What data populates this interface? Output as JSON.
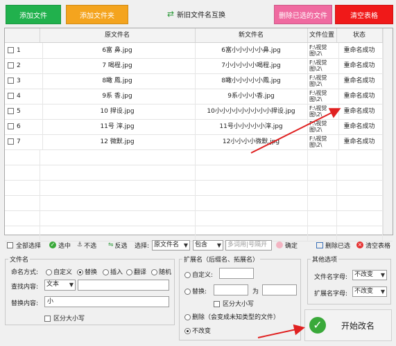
{
  "colors": {
    "add_file": "#21b14d",
    "add_folder": "#f4a41e",
    "delete_selected": "#f06aa0",
    "clear_table": "#f01919",
    "arrow": "#e02020",
    "success_green": "#3aa93a"
  },
  "top_buttons": {
    "add_file": "添加文件",
    "add_folder": "添加文件夹",
    "swap": "新旧文件名互换",
    "delete_selected": "删除已选的文件",
    "clear_table": "清空表格"
  },
  "table": {
    "headers": {
      "orig": "原文件名",
      "new": "新文件名",
      "loc": "文件位置",
      "status": "状态"
    },
    "rows": [
      {
        "num": "1",
        "orig": "6富    鼻.jpg",
        "new": "6富小小小小小鼻.jpg",
        "loc1": "F:\\视觉",
        "loc2": "图\\2\\",
        "status": "重命名成功"
      },
      {
        "num": "2",
        "orig": "7    喝程.jpg",
        "new": "7小小小小小喝程.jpg",
        "loc1": "F:\\视觉",
        "loc2": "图\\2\\",
        "status": "重命名成功"
      },
      {
        "num": "3",
        "orig": "8瞰      鳳.jpg",
        "new": "8瞰小小小小小鳳.jpg",
        "loc1": "F:\\视觉",
        "loc2": "图\\2\\",
        "status": "重命名成功"
      },
      {
        "num": "4",
        "orig": "9系  香.jpg",
        "new": "9系小小小香.jpg",
        "loc1": "F:\\视觉",
        "loc2": "图\\2\\",
        "status": "重命名成功"
      },
      {
        "num": "5",
        "orig": "10          捍设.jpg",
        "new": "10小小小小小小小小小捍设.jpg",
        "loc1": "F:\\视觉",
        "loc2": "图\\2\\",
        "status": "重命名成功"
      },
      {
        "num": "6",
        "orig": "11号      滓.jpg",
        "new": "11号小小小小小滓.jpg",
        "loc1": "F:\\视觉",
        "loc2": "图\\2\\",
        "status": "重命名成功"
      },
      {
        "num": "7",
        "orig": "12    微默.jpg",
        "new": "12小小小小微默.jpg",
        "loc1": "F:\\视觉",
        "loc2": "图\\2\\",
        "status": "重命名成功"
      }
    ]
  },
  "toolbar": {
    "select_all": "全部选择",
    "select_checked": "选中",
    "deselect": "不选",
    "invert": "反选",
    "choose_label": "选择:",
    "choose_value": "原文件名",
    "contain_value": "包含",
    "multi_placeholder": "多词用|号隔开",
    "confirm": "确定",
    "delete_selected": "删除已选",
    "clear_table": "清空表格"
  },
  "filename_group": {
    "title": "文件名",
    "mode_label": "命名方式:",
    "modes": [
      "自定义",
      "替换",
      "插入",
      "翻译",
      "随机"
    ],
    "find_label": "查找内容:",
    "find_type": "文本",
    "find_value": "",
    "replace_label": "替换内容:",
    "replace_value": "小",
    "case_label": "区分大小写"
  },
  "ext_group": {
    "title": "扩展名（后缀名、拓展名）",
    "custom": "自定义:",
    "replace": "替换:",
    "as": "为",
    "case_label": "区分大小写",
    "delete": "删除（会变成未知类型的文件）",
    "unchanged": "不改变"
  },
  "other_group": {
    "title": "其他选项",
    "file_case_label": "文件名字母:",
    "file_case_value": "不改变",
    "ext_case_label": "扩展名字母:",
    "ext_case_value": "不改变"
  },
  "start": {
    "label": "开始改名"
  }
}
